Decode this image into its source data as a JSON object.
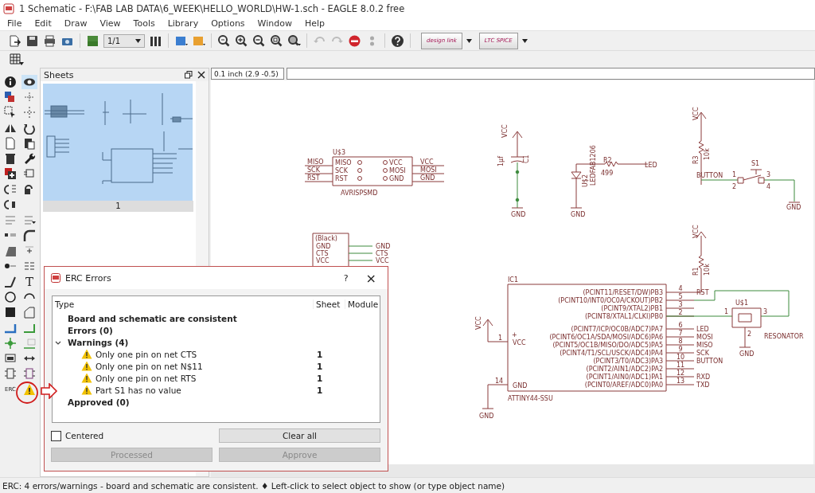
{
  "window": {
    "title": "1 Schematic - F:\\FAB LAB DATA\\6_WEEK\\HELLO_WORLD\\HW-1.sch - EAGLE 8.0.2 free"
  },
  "menu": [
    "File",
    "Edit",
    "Draw",
    "View",
    "Tools",
    "Library",
    "Options",
    "Window",
    "Help"
  ],
  "toolbar": {
    "sheet_select": "1/1",
    "logos": [
      "design link",
      "LTC SPICE"
    ]
  },
  "toolbox": {
    "text_tool": "T",
    "erc_label": "ERC"
  },
  "sheets_panel": {
    "title": "Sheets",
    "sheets": [
      {
        "label": "1",
        "selected": true
      }
    ]
  },
  "coordinates": "0.1 inch (2.9 -0.5)",
  "schematic_texts": [
    "U$3",
    "MISO",
    "SCK",
    "RST",
    "MISO",
    "SCK",
    "RST",
    "VCC",
    "MOSI",
    "GND",
    "VCC",
    "MOSI",
    "GND",
    "AVRISPSMD",
    "VCC",
    "1µf",
    "C1",
    "GND",
    "U$2",
    "LEDFAB1206",
    "R2",
    "499",
    "LED",
    "GND",
    "VCC",
    "R3",
    "10k",
    "S1",
    "BUTTON",
    "1",
    "3",
    "2",
    "4",
    "GND",
    "(Black)",
    "GND",
    "CTS",
    "VCC",
    "GND",
    "CTS",
    "VCC",
    "IC1",
    "(PCINT11/RESET/DW)PB3",
    "(PCINT10/INT0/OC0A/CKOUT)PB2",
    "(PCINT9/XTAL2)PB1",
    "(PCINT8/XTAL1/CLKI)PB0",
    "(PCINT7/ICP/OC0B/ADC7)PA7",
    "(PCINT6/OC1A/SDA/MOSI/ADC6)PA6",
    "(PCINT5/OC1B/MISO/DO/ADC5)PA5",
    "(PCINT4/T1/SCL/USCK/ADC4)PA4",
    "(PCINT3/T0/ADC3)PA3",
    "(PCINT2/AIN1/ADC2)PA2",
    "(PCINT1/AIN0/ADC1)PA1",
    "(PCINT0/AREF/ADC0)PA0",
    "4",
    "5",
    "3",
    "2",
    "6",
    "7",
    "8",
    "9",
    "10",
    "11",
    "12",
    "13",
    "RST",
    "LED",
    "MOSI",
    "MISO",
    "SCK",
    "BUTTON",
    "RXD",
    "TXD",
    "ATTINY44-SSU",
    "VCC",
    "1",
    "+",
    "VCC",
    "14",
    "GND",
    "GND",
    "VCC",
    "R1",
    "10k",
    "U$1",
    "RESONATOR",
    "GND",
    "1",
    "3",
    "2"
  ],
  "erc_dialog": {
    "title": "ERC Errors",
    "help": "?",
    "close": "×",
    "columns": [
      "Type",
      "Sheet",
      "Module"
    ],
    "items": [
      {
        "text": "Board and schematic are consistent"
      },
      {
        "text": "Errors (0)"
      },
      {
        "text": "Warnings (4)",
        "expanded": true,
        "children": [
          {
            "text": "Only one pin on net CTS",
            "sheet": "1"
          },
          {
            "text": "Only one pin on net N$11",
            "sheet": "1"
          },
          {
            "text": "Only one pin on net RTS",
            "sheet": "1"
          },
          {
            "text": "Part S1 has no value",
            "sheet": "1"
          }
        ]
      },
      {
        "text": "Approved (0)"
      }
    ],
    "centered": {
      "label": "Centered",
      "checked": false
    },
    "buttons": [
      {
        "label": "Clear all",
        "disabled": false
      },
      {
        "label": "Processed",
        "disabled": true
      },
      {
        "label": "Approve",
        "disabled": true
      }
    ]
  },
  "status_bar": "ERC: 4 errors/warnings - board and schematic are consistent.  ♦ Left-click to select object to show (or type object name)"
}
